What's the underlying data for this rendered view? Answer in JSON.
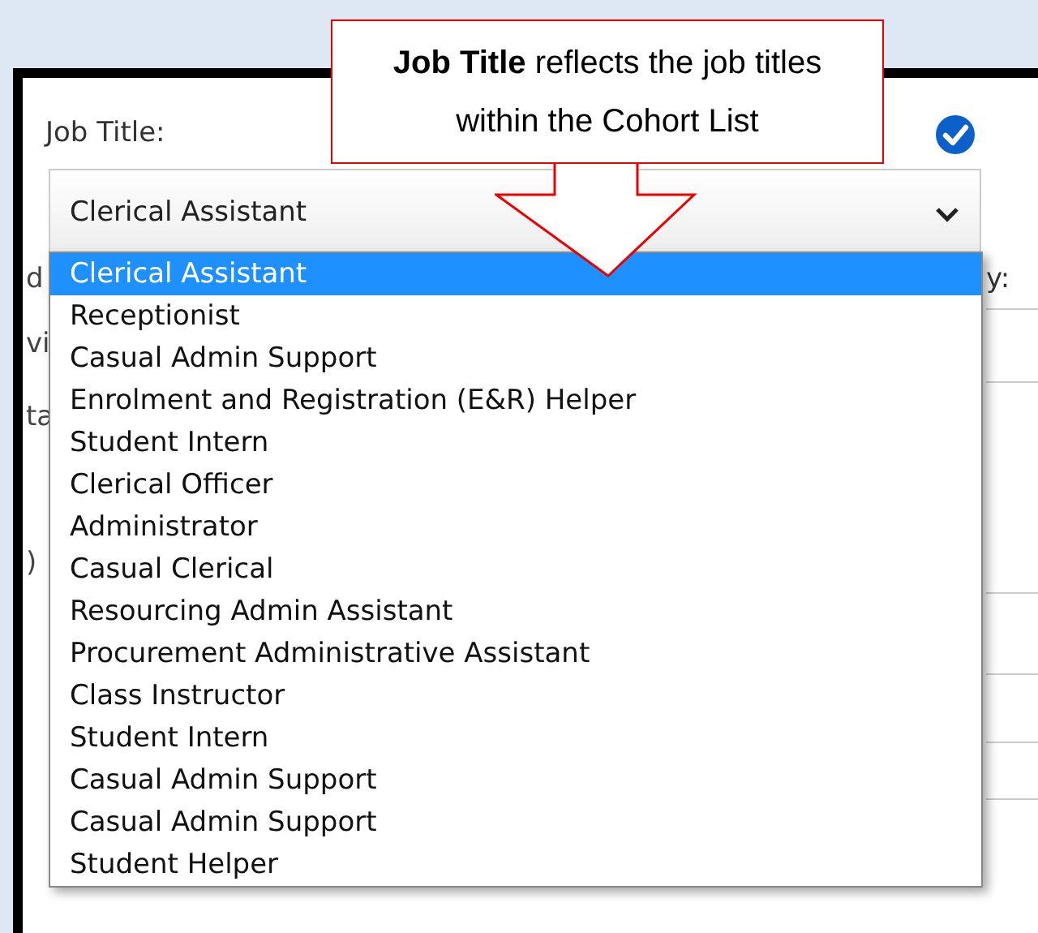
{
  "callout": {
    "text": "**Job Title** reflects the job titles within the Cohort List"
  },
  "field": {
    "label": "Job Title:",
    "checked": true,
    "value": "Clerical Assistant"
  },
  "left_fragments": [
    "d",
    "vi",
    "ta",
    ")"
  ],
  "right_fragments": [
    "y:"
  ],
  "options": [
    {
      "label": "Clerical Assistant",
      "selected": true
    },
    {
      "label": "Receptionist",
      "selected": false
    },
    {
      "label": "Casual Admin Support",
      "selected": false
    },
    {
      "label": "Enrolment and Registration (E&R) Helper",
      "selected": false
    },
    {
      "label": "Student Intern",
      "selected": false
    },
    {
      "label": "Clerical Officer",
      "selected": false
    },
    {
      "label": "Administrator",
      "selected": false
    },
    {
      "label": "Casual Clerical",
      "selected": false
    },
    {
      "label": "Resourcing Admin Assistant",
      "selected": false
    },
    {
      "label": "Procurement Administrative Assistant",
      "selected": false
    },
    {
      "label": "Class Instructor",
      "selected": false
    },
    {
      "label": "Student Intern",
      "selected": false
    },
    {
      "label": "Casual Admin Support",
      "selected": false
    },
    {
      "label": "Casual Admin Support",
      "selected": false
    },
    {
      "label": "Student Helper",
      "selected": false
    }
  ]
}
